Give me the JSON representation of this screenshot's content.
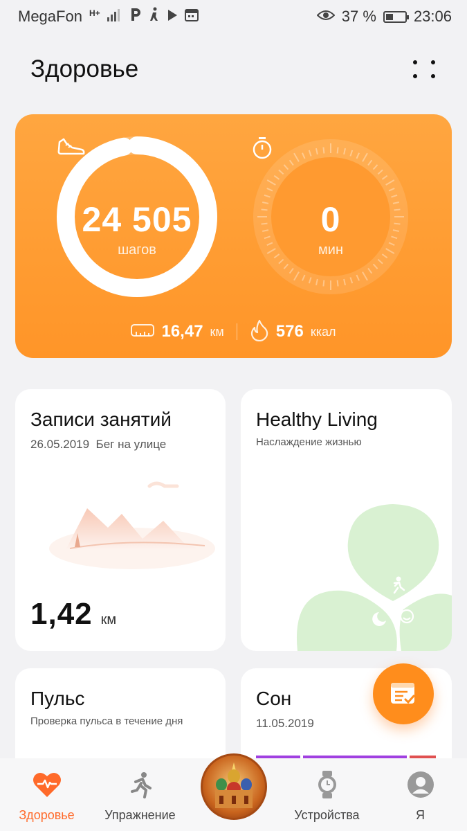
{
  "status_bar": {
    "carrier": "MegaFon",
    "network": "H+",
    "battery_percent": "37 %",
    "battery_level": 0.37,
    "time": "23:06"
  },
  "header": {
    "title": "Здоровье"
  },
  "activity": {
    "steps_value": "24 505",
    "steps_unit": "шагов",
    "steps_progress": 0.97,
    "time_value": "0",
    "time_unit": "мин",
    "distance_value": "16,47",
    "distance_unit": "км",
    "calories_value": "576",
    "calories_unit": "ккал"
  },
  "cards": {
    "records": {
      "title": "Записи занятий",
      "date": "26.05.2019",
      "activity": "Бег на улице",
      "distance_value": "1,42",
      "distance_unit": "км"
    },
    "healthy": {
      "title": "Healthy Living",
      "subtitle": "Наслаждение жизнью"
    },
    "pulse": {
      "title": "Пульс",
      "subtitle": "Проверка пульса в течение дня"
    },
    "sleep": {
      "title": "Сон",
      "date": "11.05.2019"
    }
  },
  "colors": {
    "accent": "#ff8d1c",
    "active_tab": "#ff6a2a",
    "clover": "#d9f1d2"
  },
  "tabs": [
    {
      "label": "Здоровье",
      "icon": "heart-pulse-icon",
      "active": true
    },
    {
      "label": "Упражнение",
      "icon": "running-icon",
      "active": false
    },
    {
      "label": "",
      "icon": "cathedral-badge",
      "active": false
    },
    {
      "label": "Устройства",
      "icon": "watch-icon",
      "active": false
    },
    {
      "label": "Я",
      "icon": "profile-icon",
      "active": false
    }
  ]
}
